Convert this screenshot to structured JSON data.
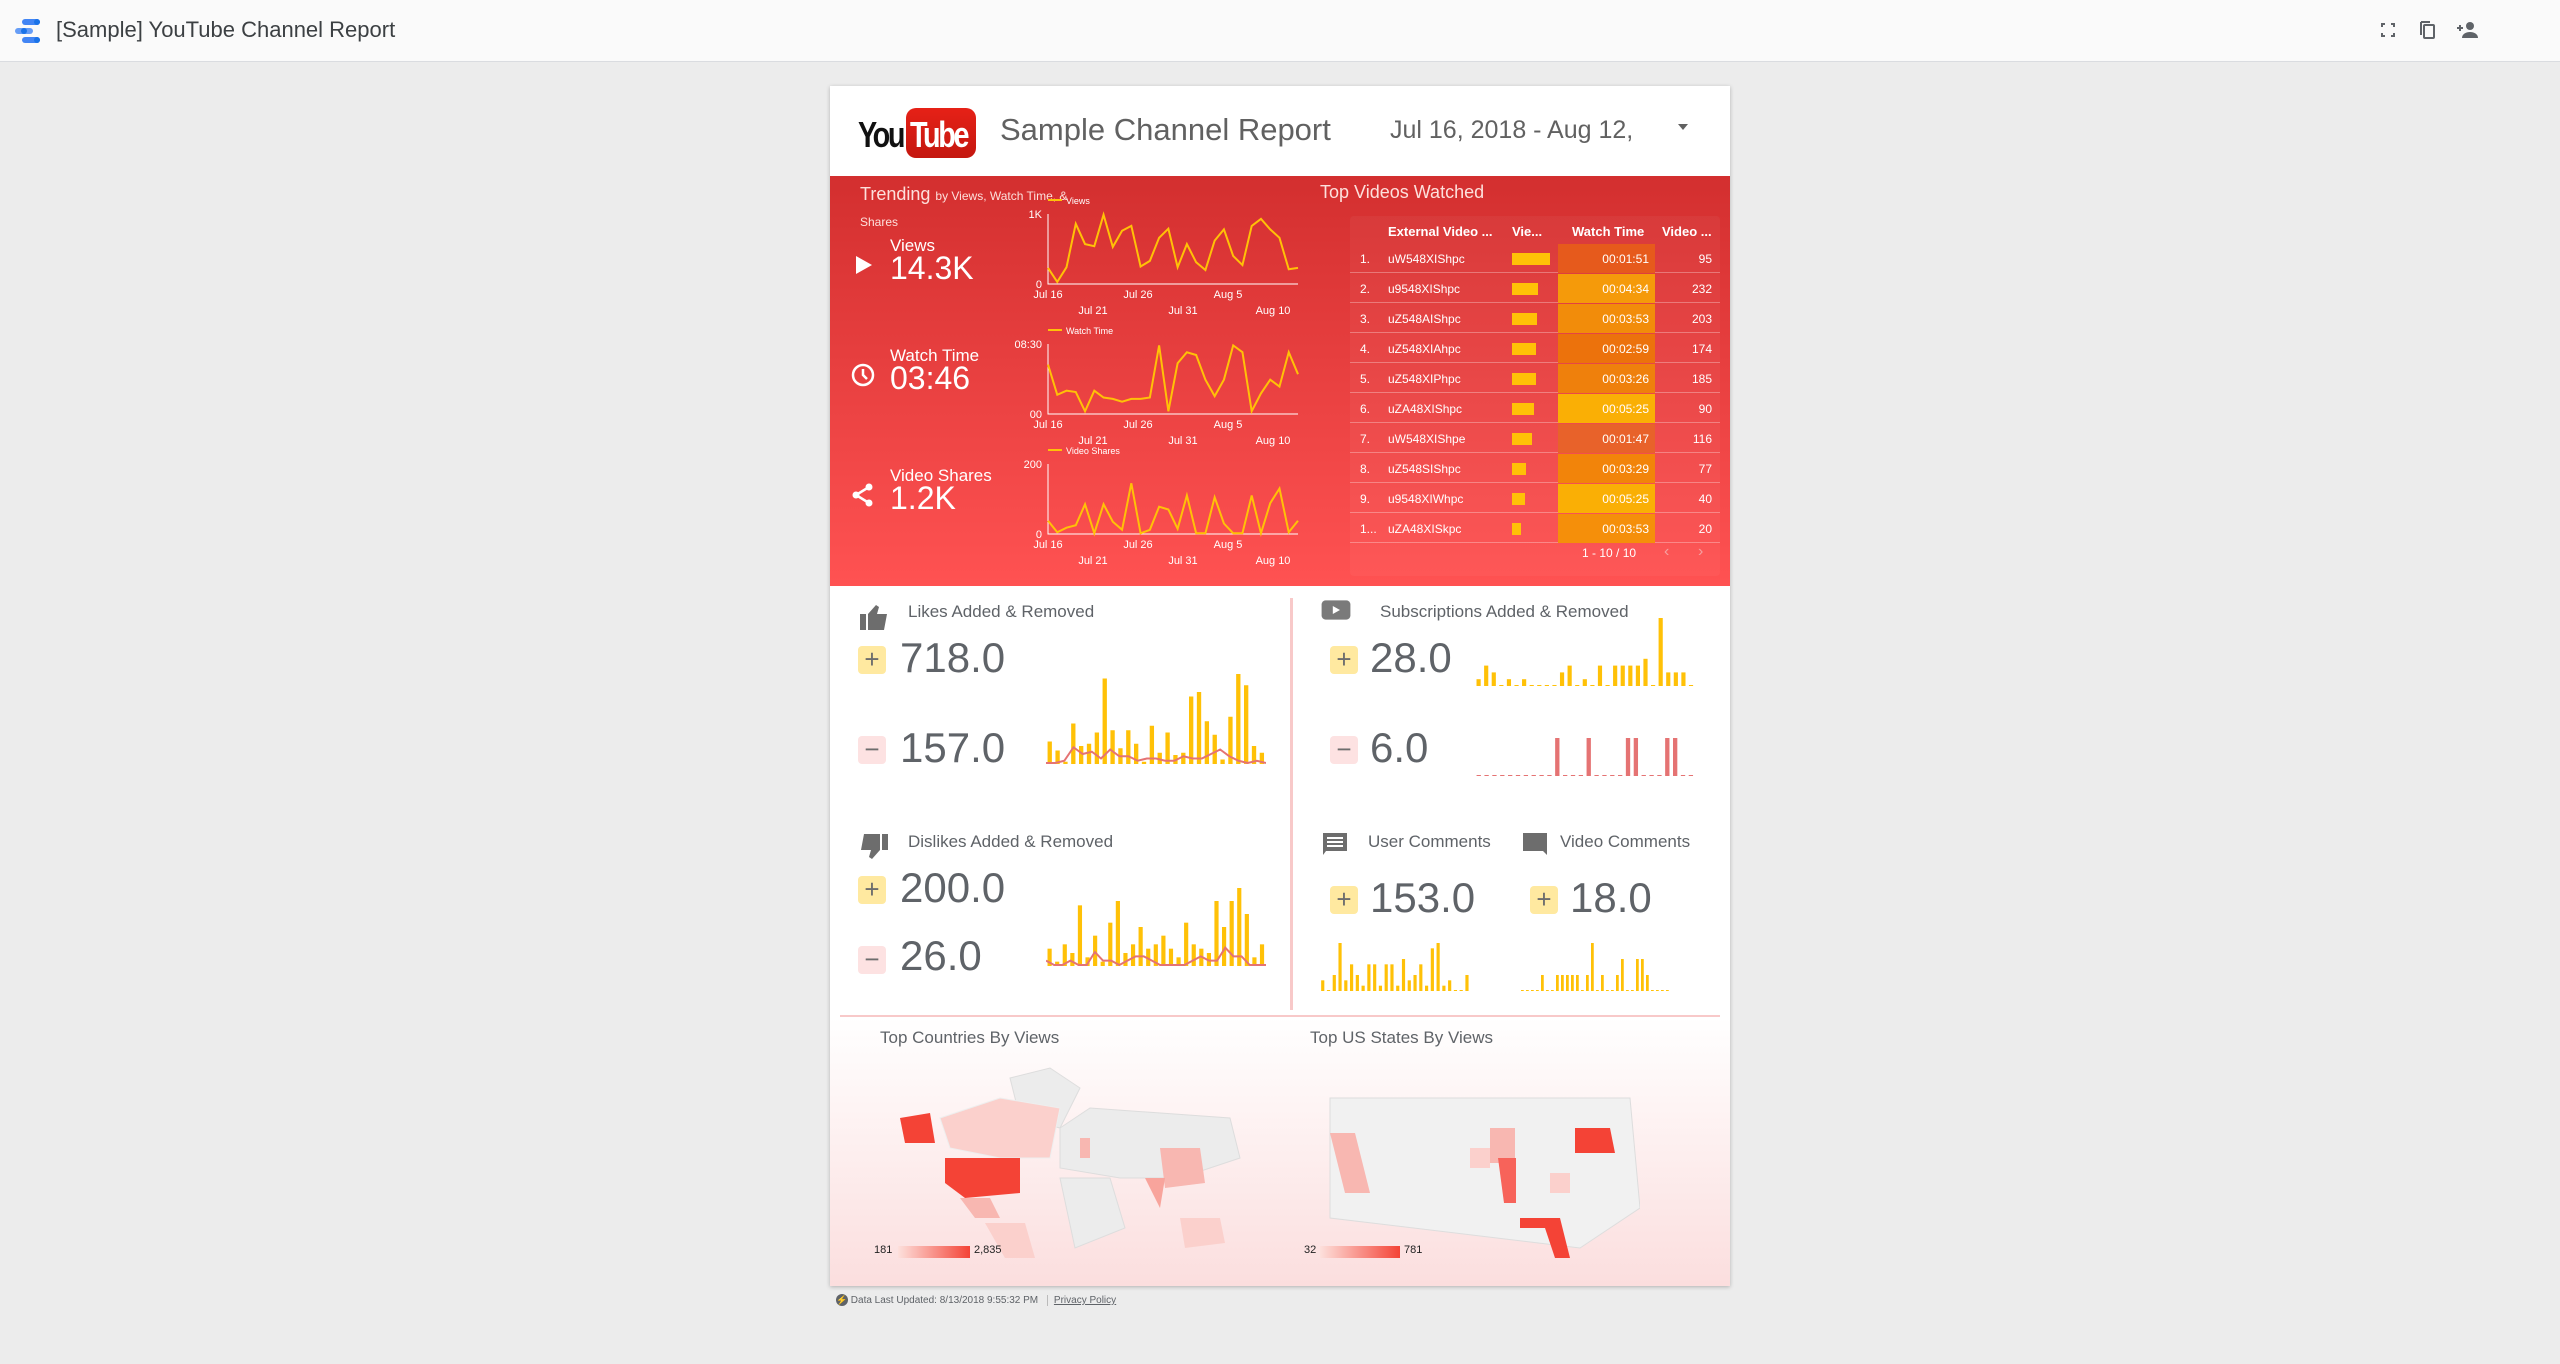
{
  "app": {
    "title": "[Sample] YouTube Channel Report",
    "toolbar_icons": [
      "fullscreen-icon",
      "copy-icon",
      "share-person-icon"
    ]
  },
  "header": {
    "logo_you": "You",
    "logo_tube": "Tube",
    "title": "Sample Channel Report",
    "date_range": "Jul 16, 2018 - Aug 12,"
  },
  "trending": {
    "title": "Trending",
    "subtitle": "by Views, Watch Time, & Shares",
    "metrics": [
      {
        "label": "Views",
        "value": "14.3K",
        "icon": "play-icon",
        "legend": "Views",
        "ymax_label": "1K",
        "ymin_label": "0"
      },
      {
        "label": "Watch Time",
        "value": "03:46",
        "icon": "clock-icon",
        "legend": "Watch Time",
        "ymax_label": "08:30",
        "ymin_label": "00"
      },
      {
        "label": "Video Shares",
        "value": "1.2K",
        "icon": "share-icon",
        "legend": "Video Shares",
        "ymax_label": "200",
        "ymin_label": "0"
      }
    ],
    "x_ticks_top": [
      "Jul 16",
      "Jul 26",
      "Aug 5"
    ],
    "x_ticks_bottom": [
      "Jul 21",
      "Jul 31",
      "Aug 10"
    ]
  },
  "chart_data": [
    {
      "type": "line",
      "title": "Views",
      "ylim": [
        0,
        1000
      ],
      "x_start": "Jul 16",
      "x_end": "Aug 12",
      "values": [
        230,
        30,
        240,
        860,
        570,
        540,
        990,
        530,
        760,
        830,
        250,
        330,
        660,
        790,
        240,
        570,
        310,
        200,
        620,
        780,
        400,
        270,
        830,
        930,
        780,
        660,
        210,
        230
      ]
    },
    {
      "type": "line",
      "title": "Watch Time (seconds)",
      "ylim": [
        0,
        510
      ],
      "values": [
        360,
        140,
        170,
        160,
        20,
        170,
        120,
        110,
        90,
        110,
        110,
        120,
        500,
        20,
        370,
        450,
        430,
        250,
        130,
        250,
        500,
        450,
        20,
        150,
        250,
        200,
        450,
        290
      ]
    },
    {
      "type": "line",
      "title": "Video Shares",
      "ylim": [
        0,
        200
      ],
      "values": [
        38,
        5,
        18,
        25,
        85,
        2,
        85,
        35,
        12,
        145,
        2,
        12,
        78,
        70,
        15,
        110,
        2,
        2,
        105,
        30,
        2,
        2,
        110,
        2,
        88,
        130,
        5,
        38
      ]
    },
    {
      "type": "bar",
      "title": "Likes Added",
      "values": [
        10,
        6,
        1,
        18,
        8,
        9,
        14,
        38,
        15,
        7,
        15,
        9,
        1,
        17,
        5,
        14,
        4,
        5,
        30,
        32,
        19,
        13,
        2,
        21,
        40,
        35,
        8,
        5
      ]
    },
    {
      "type": "line",
      "title": "Likes Removed",
      "values": [
        0,
        0,
        1,
        7,
        4,
        5,
        2,
        6,
        3,
        3,
        1,
        2,
        2,
        1,
        1,
        3,
        2,
        2,
        4,
        6,
        3,
        1,
        0,
        1,
        0
      ]
    },
    {
      "type": "bar",
      "title": "Subscriptions Added",
      "values": [
        1,
        3,
        2,
        0,
        1,
        0,
        1,
        0,
        0,
        0,
        0,
        2,
        3,
        0,
        1,
        0,
        3,
        0,
        3,
        3,
        3,
        3,
        4,
        0,
        10,
        2,
        2,
        2,
        0
      ]
    },
    {
      "type": "bar",
      "title": "Subscriptions Removed",
      "values": [
        0,
        0,
        0,
        0,
        0,
        0,
        0,
        0,
        0,
        0,
        1,
        0,
        0,
        0,
        1,
        0,
        0,
        0,
        0,
        1,
        1,
        0,
        0,
        0,
        1,
        1,
        0,
        0
      ]
    },
    {
      "type": "bar",
      "title": "Dislikes Added",
      "values": [
        4,
        1,
        5,
        3,
        14,
        2,
        7,
        1,
        10,
        15,
        3,
        5,
        9,
        4,
        5,
        7,
        4,
        2,
        10,
        5,
        4,
        3,
        15,
        9,
        15,
        18,
        12,
        2,
        5
      ]
    },
    {
      "type": "line",
      "title": "Dislikes Removed",
      "values": [
        1,
        0,
        0,
        1,
        0,
        0,
        3,
        1,
        1,
        0,
        1,
        2,
        2,
        1,
        0,
        0,
        0,
        0,
        1,
        2,
        1,
        1,
        4,
        2,
        2,
        0,
        0,
        0
      ]
    },
    {
      "type": "bar",
      "title": "User Comments",
      "values": [
        2,
        0,
        3,
        9,
        2,
        5,
        3,
        1,
        5,
        5,
        1,
        5,
        5,
        1,
        6,
        2,
        3,
        5,
        1,
        8,
        9,
        1,
        2,
        0,
        0,
        3
      ]
    },
    {
      "type": "bar",
      "title": "Video Comments",
      "values": [
        0,
        0,
        0,
        0,
        1,
        0,
        0,
        1,
        1,
        1,
        1,
        1,
        0,
        1,
        3,
        0,
        1,
        0,
        0,
        1,
        2,
        0,
        0,
        2,
        2,
        1,
        0,
        0,
        0,
        0
      ]
    }
  ],
  "top_videos": {
    "title": "Top Videos Watched",
    "columns": [
      "External Video ...",
      "Vie...",
      "Watch Time",
      "Video ..."
    ],
    "rows": [
      {
        "rank": "1.",
        "id": "uW548XIShpc",
        "views_frac": 1.0,
        "watch_time": "00:01:51",
        "shares": "95",
        "wt_color": "#e65a1c"
      },
      {
        "rank": "2.",
        "id": "u9548XIShpc",
        "views_frac": 0.69,
        "watch_time": "00:04:34",
        "shares": "232",
        "wt_color": "#f59a0a"
      },
      {
        "rank": "3.",
        "id": "uZ548AIShpc",
        "views_frac": 0.67,
        "watch_time": "00:03:53",
        "shares": "203",
        "wt_color": "#f28c0a"
      },
      {
        "rank": "4.",
        "id": "uZ548XIAhpc",
        "views_frac": 0.64,
        "watch_time": "00:02:59",
        "shares": "174",
        "wt_color": "#ec720c"
      },
      {
        "rank": "5.",
        "id": "uZ548XIPhpc",
        "views_frac": 0.62,
        "watch_time": "00:03:26",
        "shares": "185",
        "wt_color": "#ef800c"
      },
      {
        "rank": "6.",
        "id": "uZA48XIShpc",
        "views_frac": 0.58,
        "watch_time": "00:05:25",
        "shares": "90",
        "wt_color": "#faaf05"
      },
      {
        "rank": "7.",
        "id": "uW548XIShpe",
        "views_frac": 0.53,
        "watch_time": "00:01:47",
        "shares": "116",
        "wt_color": "#e8622a"
      },
      {
        "rank": "8.",
        "id": "uZ548SIShpc",
        "views_frac": 0.37,
        "watch_time": "00:03:29",
        "shares": "77",
        "wt_color": "#f2840a"
      },
      {
        "rank": "9.",
        "id": "u9548XIWhpc",
        "views_frac": 0.34,
        "watch_time": "00:05:25",
        "shares": "40",
        "wt_color": "#faaf05"
      },
      {
        "rank": "1...",
        "id": "uZA48XISkpc",
        "views_frac": 0.24,
        "watch_time": "00:03:53",
        "shares": "20",
        "wt_color": "#f58f0a"
      }
    ],
    "pagination": "1 - 10 / 10"
  },
  "engagement": {
    "likes": {
      "title": "Likes Added & Removed",
      "added": "718.0",
      "removed": "157.0"
    },
    "subscriptions": {
      "title": "Subscriptions Added & Removed",
      "added": "28.0",
      "removed": "6.0"
    },
    "dislikes": {
      "title": "Dislikes Added & Removed",
      "added": "200.0",
      "removed": "26.0"
    },
    "user_comments": {
      "title": "User Comments",
      "added": "153.0"
    },
    "video_comments": {
      "title": "Video Comments",
      "added": "18.0"
    },
    "plus": "+",
    "minus": "−"
  },
  "maps": {
    "countries": {
      "title": "Top Countries By Views",
      "min": "181",
      "max": "2,835"
    },
    "states": {
      "title": "Top US States By Views",
      "min": "32",
      "max": "781"
    }
  },
  "footer": {
    "updated": "Data Last Updated: 8/13/2018 9:55:32 PM",
    "privacy": "Privacy Policy"
  },
  "colors": {
    "accent_yellow": "#ffc107",
    "removed_red": "#e57373",
    "map_max": "#f44336",
    "map_min": "#fde0dc"
  }
}
